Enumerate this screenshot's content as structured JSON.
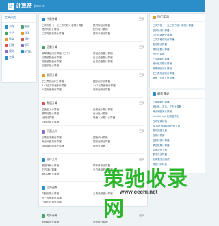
{
  "header": {
    "logo_char": "计",
    "title": "计算帝",
    "subtitle": "jisuandi"
  },
  "sidebar": {
    "title": "工具分类",
    "rows": [
      [
        "汽车",
        "国家"
      ],
      [
        "生活",
        "科学"
      ],
      [
        "教育",
        "设计"
      ],
      [
        "日常",
        "学习"
      ],
      [
        "视觉",
        "HTML"
      ],
      [
        "工具",
        ""
      ]
    ]
  },
  "main": {
    "sections": [
      {
        "title": "代数计算",
        "more": "更多",
        "rows": [
          [
            "三次方程（一元三次方程）求根计算器",
            "根式除法计算器"
          ],
          [
            "根式方程计算器",
            "配方程计算器"
          ],
          [
            "二次方程在线计算器",
            "根和系数计算器"
          ],
          [
            "",
            ""
          ]
        ]
      },
      {
        "title": "函数计算",
        "more": "更多",
        "rows": [
          [
            "解单调区间计算器（三个）",
            "基础函数值计算器"
          ],
          [
            "三角函数值计算器",
            "反三角函数计算器"
          ],
          [
            "双曲函数值计算器",
            "反双曲函数计算器"
          ],
          [
            "正弦余弦计算器",
            ""
          ]
        ]
      },
      {
        "title": "面积计算",
        "more": "更多",
        "rows": [
          [
            "正三角形面积计算器",
            "圆形面积计算器"
          ],
          [
            "3×3正方形面积计算器",
            "3×3三角面积计算器"
          ],
          [
            "六边形面积计算器",
            "扇形面积计算器"
          ],
          [
            "",
            ""
          ]
        ]
      },
      {
        "title": "数值计算",
        "more": "更多",
        "rows": [
          [
            "四舍五入计算器",
            "分数化小数计算器"
          ],
          [
            "最简分数计算器",
            "百分比计算器"
          ],
          [
            "比例计算器",
            "数值（分数）计算器"
          ],
          [
            "约数倍数计算器",
            ""
          ]
        ]
      },
      {
        "title": "平面几何",
        "more": "更多",
        "rows": [
          [
            "三角形求解计算器",
            "圆面积计算器"
          ],
          [
            "两点间距离计算器",
            "梯形面积计算器"
          ],
          [
            "点到直线距离计算器",
            "扇形计算器"
          ],
          [
            "",
            ""
          ]
        ]
      },
      {
        "title": "立体几何",
        "more": "更多",
        "rows": [
          [
            "圆锥体积计算器",
            "球体体积计算器"
          ],
          [
            "正方体计算器",
            "长方体体积计算器"
          ],
          [
            "圆柱体积计算器",
            ""
          ],
          [
            "",
            ""
          ]
        ]
      },
      {
        "title": "三角函数",
        "more": "更多",
        "rows": [
          [
            "勾股定理计算器",
            "三角函数值计算器"
          ],
          [
            "反三角函数计算器",
            ""
          ],
          [
            "三角形边角计算器",
            ""
          ],
          [
            "",
            ""
          ]
        ]
      },
      {
        "title": "矩阵计算",
        "more": "更多",
        "rows": [
          [
            "矩阵乘法计算器",
            "逆矩阵计算器"
          ]
        ]
      }
    ]
  },
  "hot_tools": {
    "title": "热门工具",
    "items": [
      "三次方程（一元三次方程）求根计算器",
      "根式除法计算器",
      "立方体体积计算器",
      "二次方程在线计算器",
      "配方程计算器",
      "根和系数计算器",
      "开方计算器",
      "三次函数计算器",
      "绝对值方程计算器",
      "解单调区间计算器",
      "正三角形面积计算器",
      "数值（分数）计算器"
    ]
  },
  "latest": {
    "title": "最新收录",
    "items": [
      "三角函数计算器",
      "绝对值、平方、立方计算器",
      "两点间距离计算器",
      "htmlformat 在线格式化",
      "在线字体转换",
      "JSON在线格式化校验工具",
      "图片压缩工具",
      "在线计算器",
      "进制转换计算器",
      "单位换算计算器",
      "文本对比工具",
      "表达式计算器",
      "正则表达式测试",
      "颜色代码转换"
    ]
  },
  "watermark": {
    "text": "策驰收录网",
    "url": "www.cechi.net"
  },
  "colors": {
    "brand": "#2c8ec8",
    "link": "#2c6e99",
    "watermark": "#2db52d"
  }
}
